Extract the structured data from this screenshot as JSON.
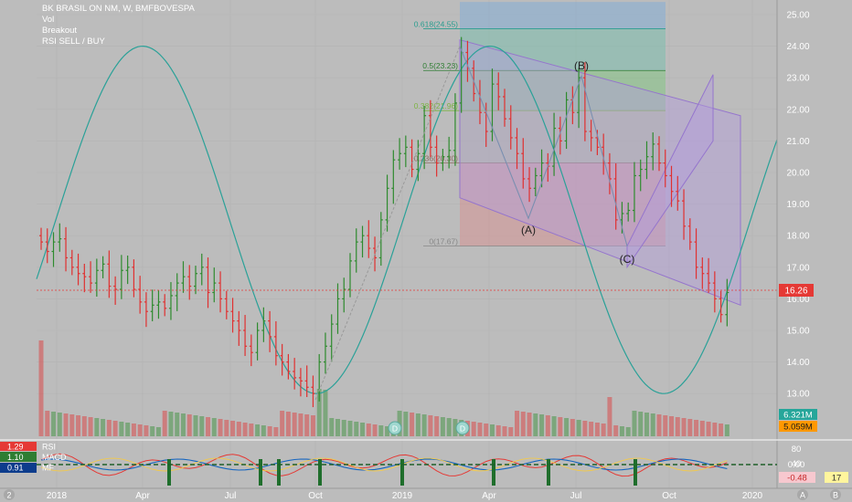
{
  "legend": {
    "symbol": "BK BRASIL ON NM, W, BMFBOVESPA",
    "items": [
      "Vol",
      "Breakout",
      "RSI SELL / BUY"
    ]
  },
  "price_axis": {
    "ticks": [
      "25.00",
      "24.00",
      "23.00",
      "22.00",
      "21.00",
      "20.00",
      "19.00",
      "18.00",
      "17.00",
      "16.00",
      "15.00",
      "14.00",
      "13.00"
    ],
    "last_price": "16.26",
    "volume_label": "6.321M",
    "volume_ma_label": "5.059M"
  },
  "indicator_axis": {
    "ticks": [
      "80",
      "40",
      "0.00"
    ],
    "value_neg": "-0.48",
    "value_right": "17"
  },
  "indicator_panel": {
    "rows": [
      {
        "value": "1.29",
        "name": "RSI"
      },
      {
        "value": "1.10",
        "name": "MACD"
      },
      {
        "value": "0.91",
        "name": "MF"
      }
    ]
  },
  "time_axis": [
    "2018",
    "Apr",
    "Jul",
    "Oct",
    "2019",
    "Apr",
    "Jul",
    "Oct",
    "2020"
  ],
  "fib_levels": [
    {
      "label": "0.618(24.55)",
      "price": 24.55
    },
    {
      "label": "0.5(23.23)",
      "price": 23.23
    },
    {
      "label": "0.382(21.96)",
      "price": 21.96
    },
    {
      "label": "0.236(20.30)",
      "price": 20.3
    },
    {
      "label": "0(17.67)",
      "price": 17.67
    }
  ],
  "wave_labels": [
    "(A)",
    "(B)",
    "(C)"
  ],
  "markers": [
    "D",
    "D"
  ],
  "bottom_left_badge": "2",
  "bottom_right_badges": [
    "A",
    "B"
  ],
  "colors": {
    "background": "#bcbcbc",
    "bull": "#2e8b2e",
    "bear": "#e03030",
    "sine": "#2aa198",
    "channel": "#b39ddb",
    "price_tag": "#e53935",
    "volume_tag": "#26a69a",
    "volume_ma_tag": "#ff9800"
  },
  "chart_data": {
    "type": "candlestick",
    "title": "BK BRASIL ON NM, W, BMFBOVESPA",
    "ylim": [
      12.2,
      25.4
    ],
    "price_axis_ticks": [
      13,
      14,
      15,
      16,
      17,
      18,
      19,
      20,
      21,
      22,
      23,
      24,
      25
    ],
    "last_close": 16.26,
    "closes": [
      17.8,
      17.5,
      17.8,
      17.9,
      17.3,
      17.0,
      16.8,
      16.7,
      16.5,
      16.9,
      17.1,
      16.4,
      16.3,
      16.9,
      17.0,
      16.3,
      15.9,
      15.6,
      15.8,
      15.9,
      15.7,
      16.1,
      16.5,
      16.7,
      16.4,
      16.8,
      17.0,
      16.2,
      16.5,
      16.0,
      15.6,
      15.3,
      15.0,
      14.5,
      14.3,
      15.0,
      15.3,
      14.8,
      14.2,
      14.0,
      13.7,
      13.5,
      13.4,
      13.2,
      13.0,
      14.0,
      14.5,
      15.2,
      16.0,
      16.3,
      17.2,
      17.8,
      18.0,
      17.6,
      17.3,
      18.5,
      19.5,
      20.4,
      20.6,
      20.8,
      20.1,
      20.6,
      21.8,
      20.8,
      20.3,
      20.5,
      20.7,
      22.2,
      23.8,
      23.3,
      22.5,
      21.9,
      21.3,
      22.8,
      22.4,
      21.7,
      21.1,
      20.6,
      19.8,
      19.5,
      19.9,
      20.3,
      20.2,
      21.4,
      21.0,
      22.3,
      21.9,
      23.0,
      21.3,
      21.1,
      20.8,
      20.3,
      19.8,
      18.5,
      18.7,
      18.8,
      19.9,
      20.1,
      20.5,
      20.9,
      20.3,
      19.9,
      19.4,
      19.1,
      18.3,
      17.8,
      17.0,
      16.8,
      16.5,
      16.0,
      15.5,
      16.2
    ],
    "trend_waves": [
      {
        "label": "(A)",
        "price": 18.55
      },
      {
        "label": "(B)",
        "price": 23.05
      },
      {
        "label": "(C)",
        "price": 17.67
      }
    ],
    "fibonacci": {
      "high": 24.55,
      "low": 17.67,
      "levels": [
        0,
        0.236,
        0.382,
        0.5,
        0.618
      ]
    },
    "time_ticks": [
      "2018",
      "Apr",
      "Jul",
      "Oct",
      "2019",
      "Apr",
      "Jul",
      "Oct",
      "2020"
    ]
  }
}
